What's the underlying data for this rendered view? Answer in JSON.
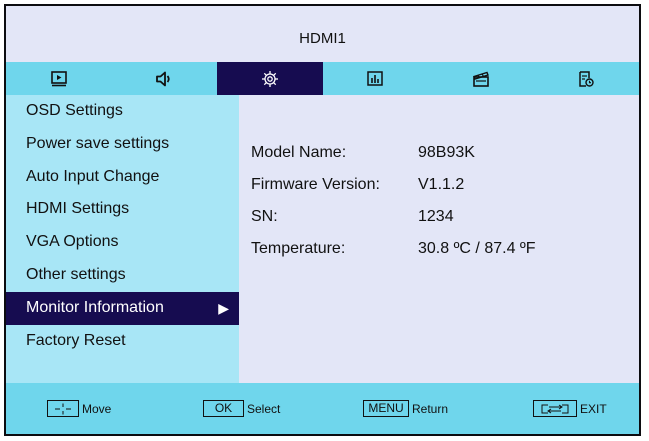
{
  "window": {
    "title": "HDMI1"
  },
  "tabs": [
    {
      "icon": "picture-icon",
      "active": false
    },
    {
      "icon": "speaker-icon",
      "active": false
    },
    {
      "icon": "settings-gear-icon",
      "active": true
    },
    {
      "icon": "equalizer-icon",
      "active": false
    },
    {
      "icon": "clapperboard-icon",
      "active": false
    },
    {
      "icon": "schedule-icon",
      "active": false
    }
  ],
  "sidebar": {
    "items": [
      {
        "label": "OSD Settings"
      },
      {
        "label": "Power save settings"
      },
      {
        "label": "Auto Input Change"
      },
      {
        "label": "HDMI Settings"
      },
      {
        "label": "VGA Options"
      },
      {
        "label": "Other settings"
      },
      {
        "label": "Monitor Information",
        "selected": true
      },
      {
        "label": "Factory Reset"
      }
    ],
    "selected_arrow": "▶"
  },
  "info": {
    "rows": [
      {
        "label": "Model Name:",
        "value": "98B93K"
      },
      {
        "label": "Firmware Version:",
        "value": "V1.1.2"
      },
      {
        "label": "SN:",
        "value": "1234"
      },
      {
        "label": "Temperature:",
        "value": "30.8 ºC / 87.4 ºF"
      }
    ]
  },
  "footer": {
    "hints": [
      {
        "key_icon": "move-arrows-icon",
        "key": "",
        "label": "Move"
      },
      {
        "key_icon": "",
        "key": "OK",
        "label": "Select"
      },
      {
        "key_icon": "",
        "key": "MENU",
        "label": "Return"
      },
      {
        "key_icon": "exit-input-icon",
        "key": "",
        "label": "EXIT"
      }
    ]
  },
  "colors": {
    "accent_dark": "#160c50",
    "tab_bar": "#6fd6ec",
    "sidebar": "#a8e6f6",
    "panel": "#e3e6f7"
  }
}
